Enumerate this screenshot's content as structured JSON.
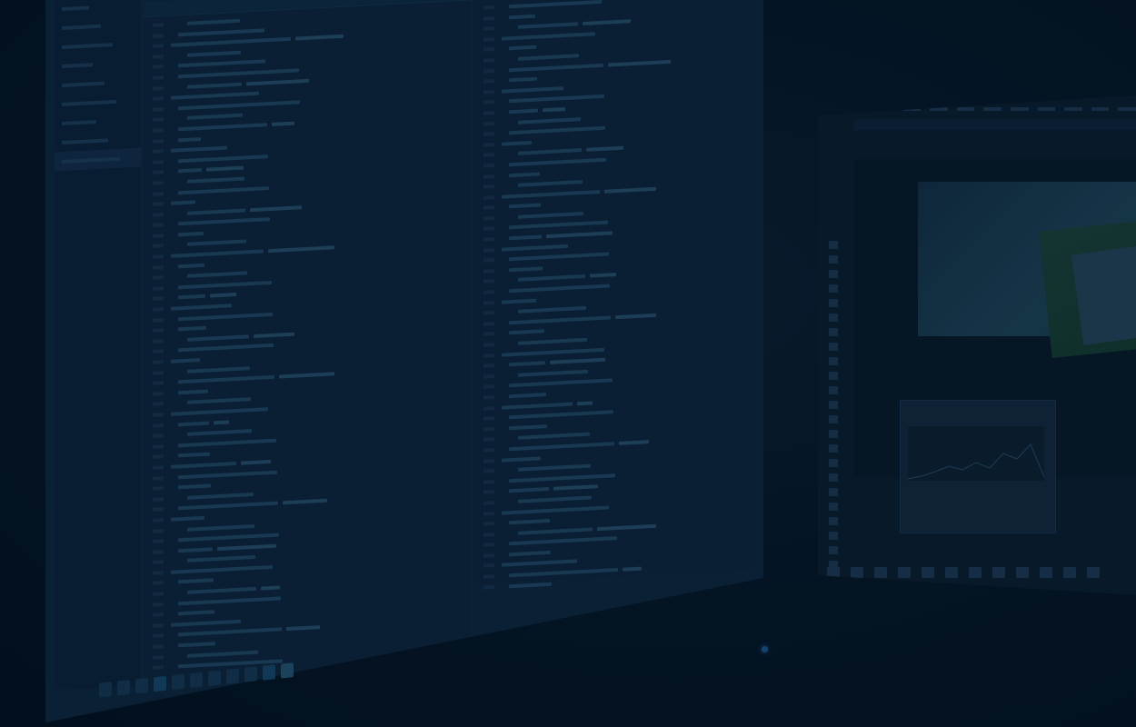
{
  "scene": {
    "description_tags": [
      "dual-monitors",
      "code-editor",
      "photo-editor"
    ],
    "colors": {
      "background": "#04121f",
      "screen_tint": "#0f2a42",
      "accent": "#1f5fa0"
    }
  },
  "left_monitor": {
    "sidebar_items": 9,
    "code_pane_1_lines": 62,
    "code_pane_2_lines": 56,
    "taskbar_icons": [
      "windows-icon",
      "search-icon",
      "task-view-icon",
      "edge-icon",
      "explorer-icon",
      "store-icon",
      "files-icon",
      "chrome-icon",
      "terminal-icon",
      "editor-icon",
      "app-icon"
    ]
  },
  "right_monitor": {
    "tool_count": 24,
    "menu_count": 12,
    "status_icons": 12
  }
}
